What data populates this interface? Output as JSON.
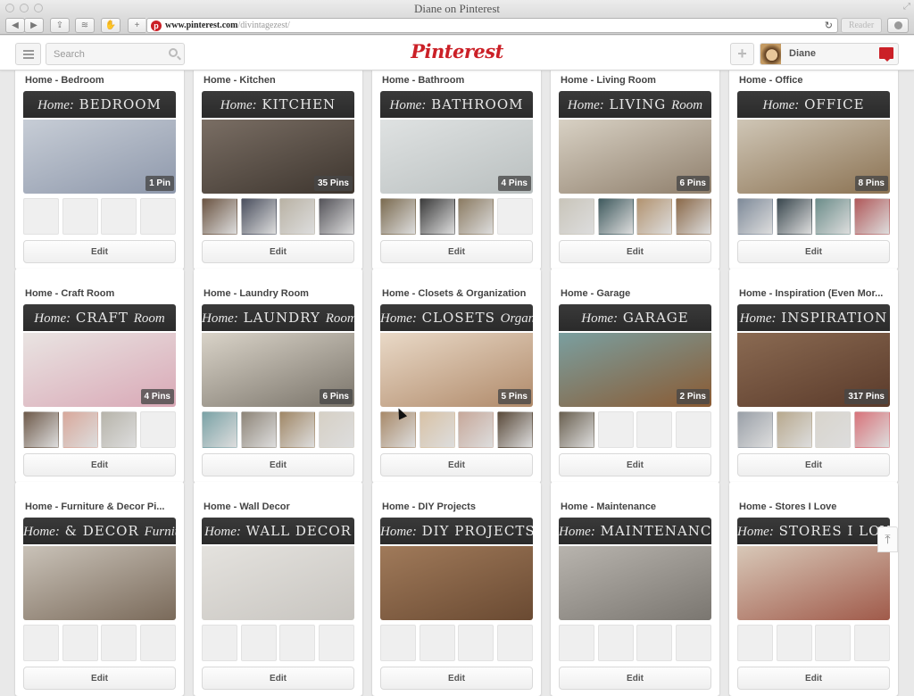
{
  "window": {
    "title": "Diane on Pinterest",
    "url_host": "www.pinterest.com",
    "url_path": "/divintagezest/",
    "reader_label": "Reader",
    "back_icon": "◀",
    "forward_icon": "▶",
    "share_icon": "⇪",
    "layers_icon": "≋",
    "plugin_icon": "✋",
    "new_tab_icon": "+",
    "reload_icon": "↻"
  },
  "header": {
    "logo": "Pinterest",
    "search_placeholder": "Search",
    "add_icon": "+",
    "user_name": "Diane",
    "brand_color": "#cb2027"
  },
  "boards": [
    {
      "title": "Home - Bedroom",
      "banner_script": "Home:",
      "banner_text": "BEDROOM",
      "pin_count": "1 Pin",
      "filled_thumbs": 0,
      "photo_colors": [
        "#c7cdd6",
        "#8e98ab"
      ],
      "thumb_colors": [],
      "edit_label": "Edit"
    },
    {
      "title": "Home - Kitchen",
      "banner_script": "Home:",
      "banner_text": "KITCHEN",
      "pin_count": "35 Pins",
      "filled_thumbs": 4,
      "photo_colors": [
        "#7a6e64",
        "#3d352e"
      ],
      "thumb_colors": [
        "#6b5442",
        "#4a4f5e",
        "#b9b2a4",
        "#55545a"
      ],
      "edit_label": "Edit"
    },
    {
      "title": "Home - Bathroom",
      "banner_script": "Home:",
      "banner_text": "BATHROOM",
      "pin_count": "4 Pins",
      "filled_thumbs": 3,
      "photo_colors": [
        "#dfe2e2",
        "#b9bfbf"
      ],
      "thumb_colors": [
        "#7b6b50",
        "#3b3b3b",
        "#8b7b62"
      ],
      "edit_label": "Edit"
    },
    {
      "title": "Home - Living Room",
      "banner_script": "Home:",
      "banner_text": "LIVING",
      "banner_suffix": "Room",
      "pin_count": "6 Pins",
      "filled_thumbs": 4,
      "photo_colors": [
        "#d8d1c4",
        "#8f7f6c"
      ],
      "thumb_colors": [
        "#c9c5ba",
        "#3f5a5e",
        "#b29370",
        "#8b6a4a"
      ],
      "edit_label": "Edit"
    },
    {
      "title": "Home - Office",
      "banner_script": "Home:",
      "banner_text": "OFFICE",
      "pin_count": "8 Pins",
      "filled_thumbs": 4,
      "photo_colors": [
        "#cfc6b6",
        "#8b7252"
      ],
      "thumb_colors": [
        "#7e8a99",
        "#39474e",
        "#6c8d8a",
        "#b0595a"
      ],
      "edit_label": "Edit"
    },
    {
      "title": "Home - Craft Room",
      "banner_script": "Home:",
      "banner_text": "CRAFT",
      "banner_suffix": "Room",
      "pin_count": "4 Pins",
      "filled_thumbs": 3,
      "photo_colors": [
        "#e9e4e2",
        "#d9a8b6"
      ],
      "thumb_colors": [
        "#6e5a4a",
        "#d8a89b",
        "#b7b4aa"
      ],
      "edit_label": "Edit"
    },
    {
      "title": "Home - Laundry Room",
      "banner_script": "Home:",
      "banner_text": "LAUNDRY",
      "banner_suffix": "Room",
      "pin_count": "6 Pins",
      "filled_thumbs": 4,
      "photo_colors": [
        "#d9d3c8",
        "#7a746a"
      ],
      "thumb_colors": [
        "#7aa2a6",
        "#8e8578",
        "#a08766",
        "#d6d0c5"
      ],
      "edit_label": "Edit"
    },
    {
      "title": "Home - Closets & Organization",
      "banner_script": "Home:",
      "banner_text": "CLOSETS",
      "banner_suffix": "Organization &",
      "pin_count": "5 Pins",
      "filled_thumbs": 4,
      "photo_colors": [
        "#e9d9c7",
        "#b08a6a"
      ],
      "thumb_colors": [
        "#a88a6a",
        "#d8c2a6",
        "#c7a89a",
        "#5a4a3a"
      ],
      "edit_label": "Edit"
    },
    {
      "title": "Home - Garage",
      "banner_script": "Home:",
      "banner_text": "GARAGE",
      "pin_count": "2 Pins",
      "filled_thumbs": 1,
      "photo_colors": [
        "#7a9fa0",
        "#8a5a32"
      ],
      "thumb_colors": [
        "#6a6050"
      ],
      "edit_label": "Edit"
    },
    {
      "title": "Home - Inspiration (Even Mor...",
      "banner_script": "Home:",
      "banner_text": "INSPIRATION",
      "pin_count": "317 Pins",
      "filled_thumbs": 4,
      "photo_colors": [
        "#8a6a52",
        "#5a3a2a"
      ],
      "thumb_colors": [
        "#9aa0a8",
        "#b8a98e",
        "#d8d4cc",
        "#d8737a"
      ],
      "edit_label": "Edit"
    },
    {
      "title": "Home - Furniture & Decor Pi...",
      "banner_script": "Home:",
      "banner_text": "& DECOR",
      "banner_suffix": "Furniture",
      "pin_count": "",
      "filled_thumbs": 0,
      "photo_colors": [
        "#c9c2b8",
        "#7a6a5a"
      ],
      "thumb_colors": [],
      "edit_label": "Edit"
    },
    {
      "title": "Home - Wall Decor",
      "banner_script": "Home:",
      "banner_text": "WALL DECOR",
      "pin_count": "",
      "filled_thumbs": 0,
      "photo_colors": [
        "#e4e2de",
        "#c8c5c0"
      ],
      "thumb_colors": [],
      "edit_label": "Edit"
    },
    {
      "title": "Home - DIY Projects",
      "banner_script": "Home:",
      "banner_text": "DIY PROJECTS",
      "pin_count": "",
      "filled_thumbs": 0,
      "photo_colors": [
        "#a07a5a",
        "#6a4a32"
      ],
      "thumb_colors": [],
      "edit_label": "Edit"
    },
    {
      "title": "Home - Maintenance",
      "banner_script": "Home:",
      "banner_text": "MAINTENANCE",
      "pin_count": "",
      "filled_thumbs": 0,
      "photo_colors": [
        "#b8b4ae",
        "#7a7670"
      ],
      "thumb_colors": [],
      "edit_label": "Edit"
    },
    {
      "title": "Home - Stores I Love",
      "banner_script": "Home:",
      "banner_text": "STORES I LOVE",
      "pin_count": "",
      "filled_thumbs": 0,
      "photo_colors": [
        "#d8c8b8",
        "#a05a4a"
      ],
      "thumb_colors": [],
      "edit_label": "Edit"
    }
  ],
  "scroll_top_icon": "⤒"
}
